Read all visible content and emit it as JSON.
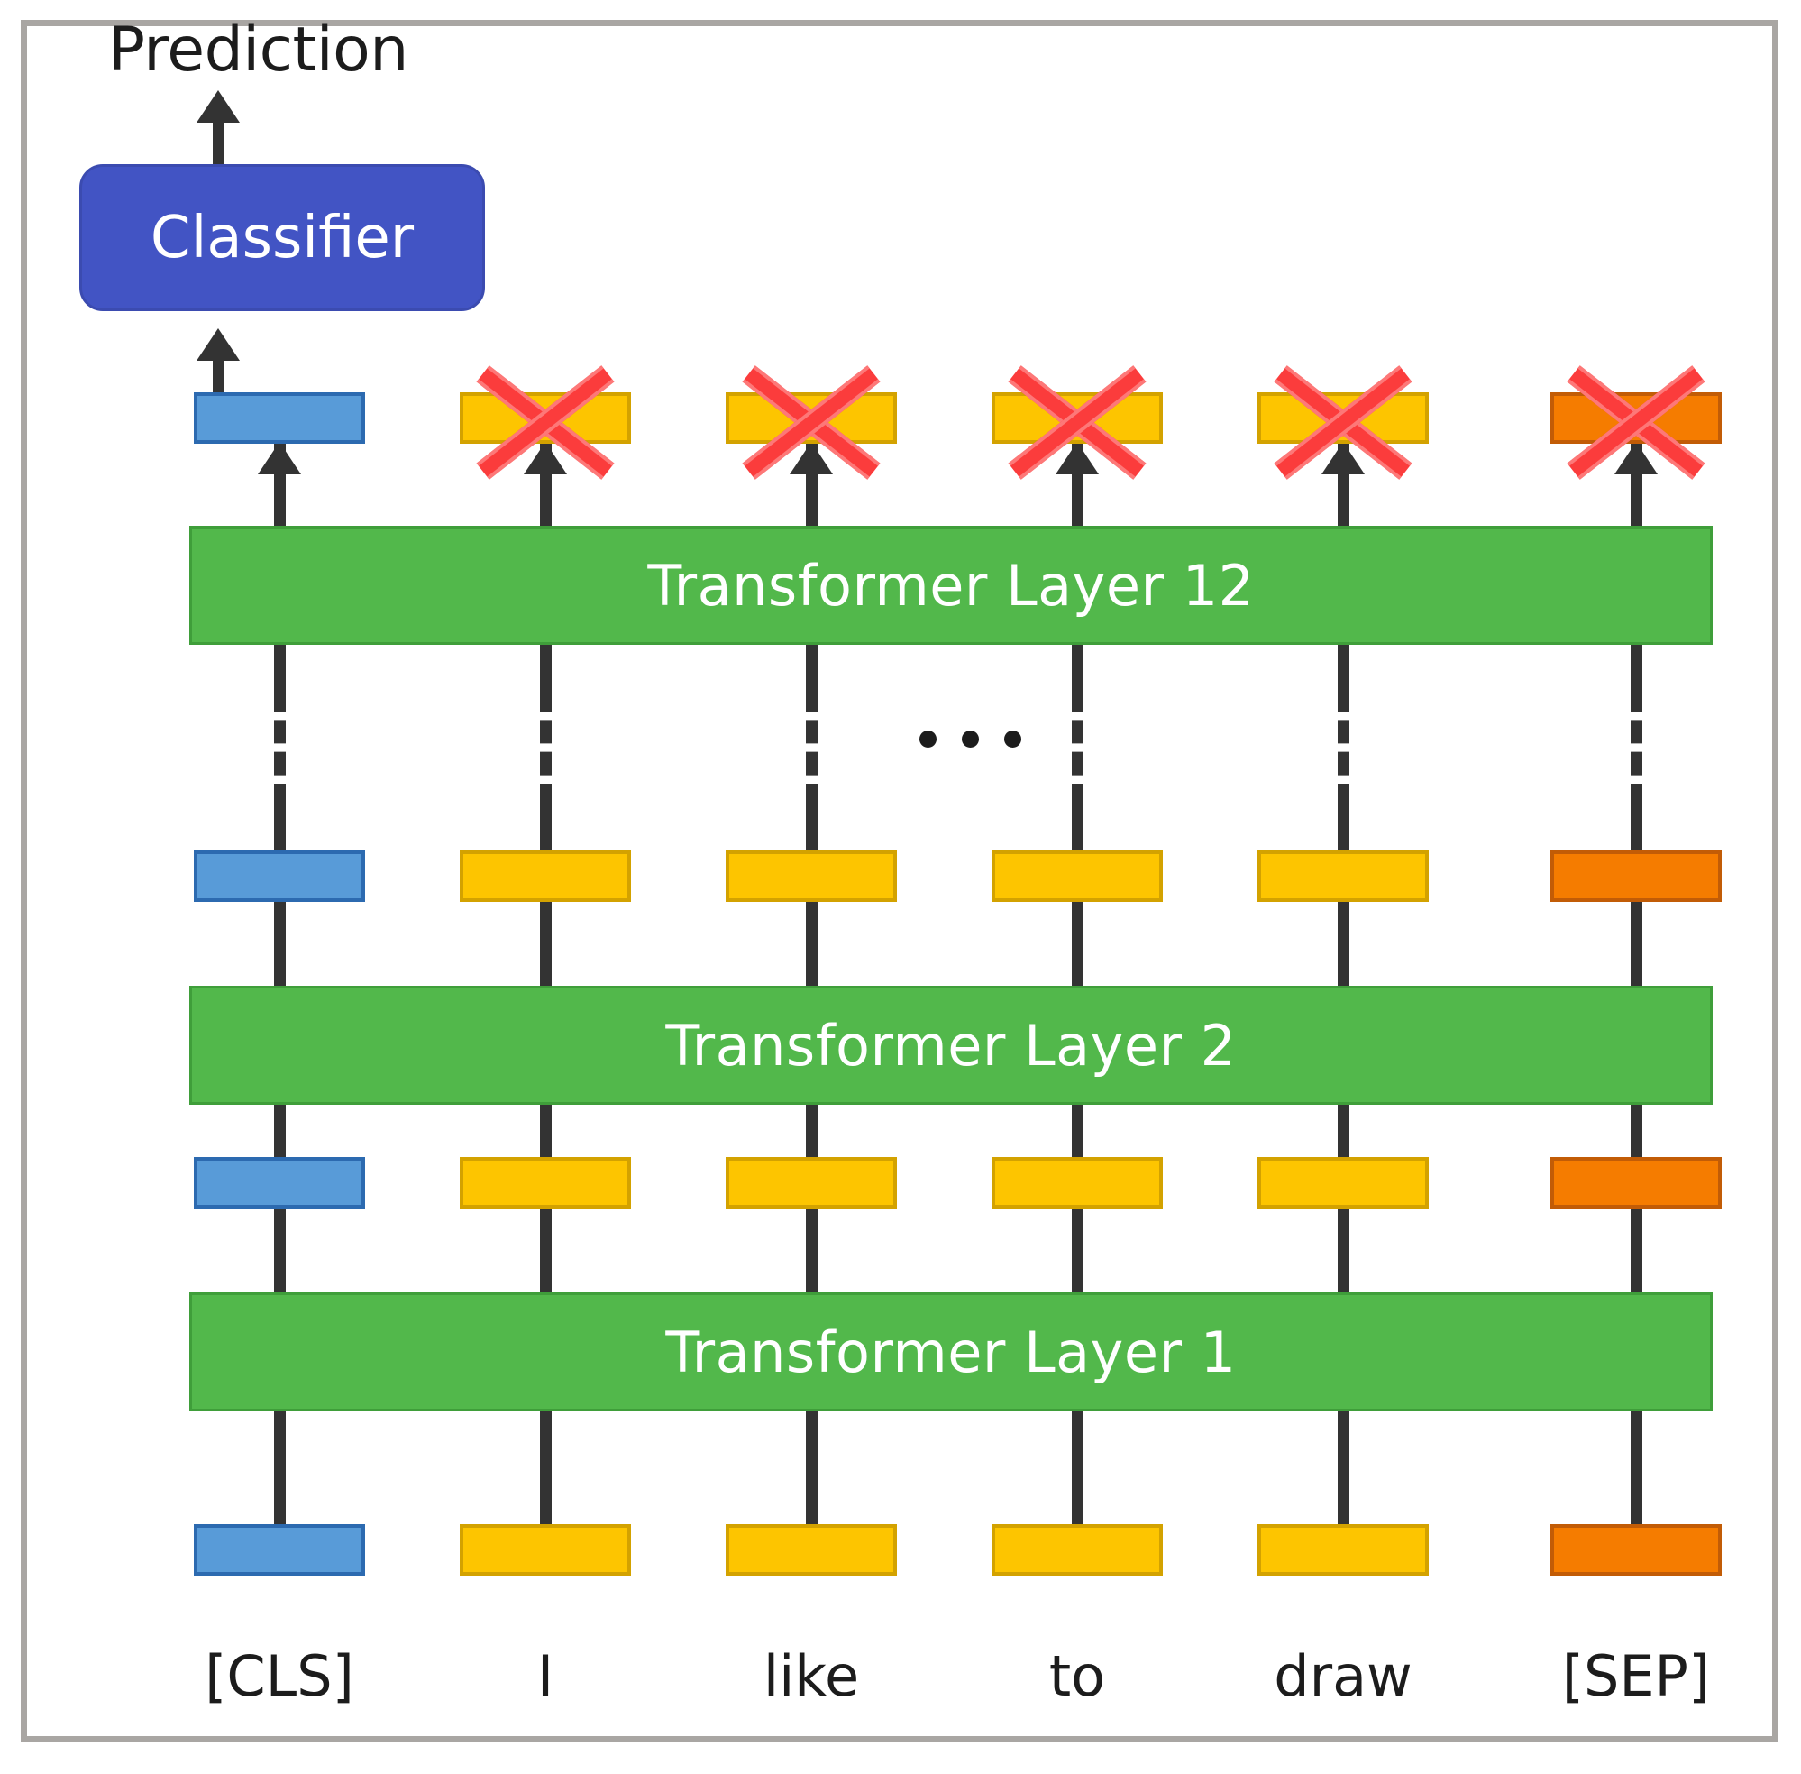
{
  "figure": {
    "prediction_label": "Prediction",
    "classifier_label": "Classifier"
  },
  "layers": [
    {
      "label": "Transformer Layer 12"
    },
    {
      "label": "Transformer Layer 2"
    },
    {
      "label": "Transformer Layer 1"
    }
  ],
  "ellipsis": "...",
  "tokens": [
    {
      "label": "[CLS]",
      "color": "blue",
      "hex": "#589bd8",
      "crossed_out_at_top": false
    },
    {
      "label": "I",
      "color": "yellow",
      "hex": "#fdc500",
      "crossed_out_at_top": true
    },
    {
      "label": "like",
      "color": "yellow",
      "hex": "#fdc500",
      "crossed_out_at_top": true
    },
    {
      "label": "to",
      "color": "yellow",
      "hex": "#fdc500",
      "crossed_out_at_top": true
    },
    {
      "label": "draw",
      "color": "yellow",
      "hex": "#fdc500",
      "crossed_out_at_top": true
    },
    {
      "label": "[SEP]",
      "color": "orange",
      "hex": "#f57c00",
      "crossed_out_at_top": true
    }
  ],
  "colors": {
    "frame_border": "#a9a6a3",
    "classifier_fill": "#4254c4",
    "transformer_fill": "#52b84b",
    "cls_token_fill": "#589bd8",
    "word_token_fill": "#fdc500",
    "sep_token_fill": "#f57c00",
    "cross_out": "#fb3c3c",
    "connector_line": "#333333",
    "background": "#ffffff"
  }
}
